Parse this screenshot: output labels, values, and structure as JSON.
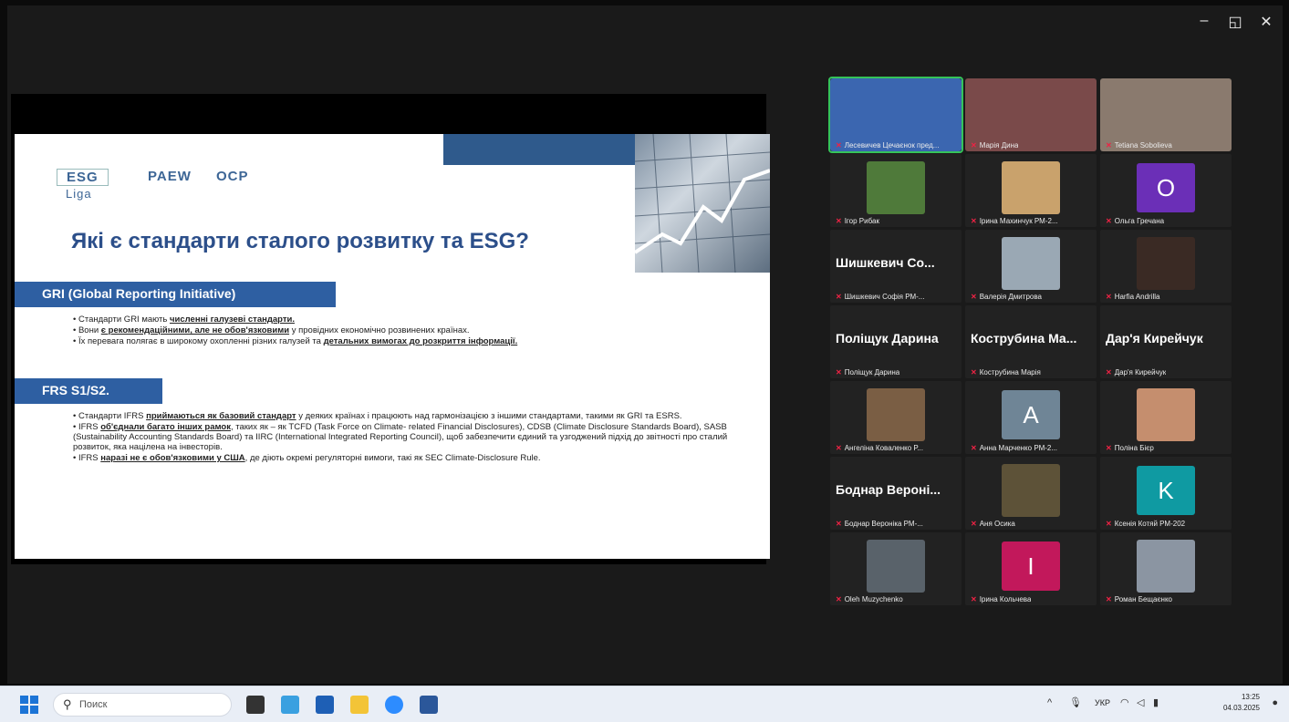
{
  "window": {
    "minimize": "–",
    "restore": "◱",
    "close": "✕"
  },
  "slide": {
    "logo_esg": "ESG",
    "logo_liga": "Liga",
    "logo_paew": "PAEW",
    "logo_ocp": "OCP",
    "title": "Які є стандарти сталого розвитку та ESG?",
    "section1": {
      "heading": "GRI (Global Reporting Initiative)",
      "bullets": [
        [
          "• Стандарти GRI мають ",
          "численні галузеві стандарти.",
          ""
        ],
        [
          "• Вони ",
          "є рекомендаційними, але не обов'язковими",
          " у провідних економічно розвинених країнах."
        ],
        [
          "• Їх перевага полягає в широкому охопленні різних галузей та ",
          "детальних вимогах до розкриття інформації.",
          ""
        ]
      ]
    },
    "section2": {
      "heading": "FRS S1/S2.",
      "bullets": [
        [
          "• Стандарти IFRS ",
          "приймаються як базовий стандарт",
          " у деяких країнах і працюють над гармонізацією з іншими стандартами, такими як GRI та ESRS."
        ],
        [
          "• IFRS ",
          "об'єднали багато інших рамок",
          ", таких як – як TCFD (Task Force on Climate- related Financial Disclosures), CDSB (Climate Disclosure Standards Board), SASB (Sustainability Accounting Standards Board) та IIRC (International Integrated Reporting Council), щоб забезпечити єдиний та узгоджений підхід до звітності про сталий розвиток, яка націлена на інвесторів."
        ],
        [
          "• IFRS ",
          "наразі не є обов'язковими у США",
          ", де діють окремі регуляторні вимоги, такі як SEC Climate-Disclosure Rule."
        ]
      ]
    }
  },
  "participants": [
    {
      "name": "Лесевичев Цечаєнок пред...",
      "type": "video",
      "color": "#3b66b0"
    },
    {
      "name": "Марія Дина",
      "type": "video",
      "color": "#7a4a4a"
    },
    {
      "name": "Tetiana Sobolieva",
      "type": "video",
      "color": "#8a7a6e"
    },
    {
      "name": "Ігор Рибак",
      "type": "video",
      "color": "#4f7a3a"
    },
    {
      "name": "Ірина Махинчук РМ-2...",
      "type": "video",
      "color": "#c9a26c"
    },
    {
      "name": "Ольга Гречана",
      "type": "letter",
      "letter": "О",
      "color": "#6b2fb7"
    },
    {
      "name": "Шишкевич Софія РМ-...",
      "big": "Шишкевич Со...",
      "type": "name"
    },
    {
      "name": "Валерія Дмитрова",
      "type": "video",
      "color": "#9aa8b4"
    },
    {
      "name": "Harfia Andrilla",
      "type": "video",
      "color": "#3a2a24"
    },
    {
      "name": "Поліщук Дарина",
      "big": "Поліщук Дарина",
      "type": "name"
    },
    {
      "name": "Кострубина Марія",
      "big": "Кострубина Ма...",
      "type": "name"
    },
    {
      "name": "Дар'я Кирейчук",
      "big": "Дар'я Кирейчук",
      "type": "name"
    },
    {
      "name": "Ангеліна Коваленко Р...",
      "type": "video",
      "color": "#7a5e44"
    },
    {
      "name": "Анна Марченко РМ-2...",
      "type": "letter",
      "letter": "A",
      "color": "#6f8596"
    },
    {
      "name": "Поліна Бієр",
      "type": "video",
      "color": "#c58e6e"
    },
    {
      "name": "Боднар Вероніка РМ-...",
      "big": "Боднар Вероні...",
      "type": "name"
    },
    {
      "name": "Аня Осика",
      "type": "video",
      "color": "#5d5238"
    },
    {
      "name": "Ксенія Котяй РМ-202",
      "type": "letter",
      "letter": "K",
      "color": "#0f9aa2"
    },
    {
      "name": "Oleh Muzychenko",
      "type": "video",
      "color": "#59626a"
    },
    {
      "name": "Ірина Кольчева",
      "type": "letter",
      "letter": "I",
      "color": "#c2185b"
    },
    {
      "name": "Роман Бещаєнко",
      "type": "video",
      "color": "#8b95a2"
    }
  ],
  "taskbar": {
    "search_placeholder": "Поиск",
    "lang": "УКР",
    "time": "13:25",
    "date": "04.03.2025"
  }
}
